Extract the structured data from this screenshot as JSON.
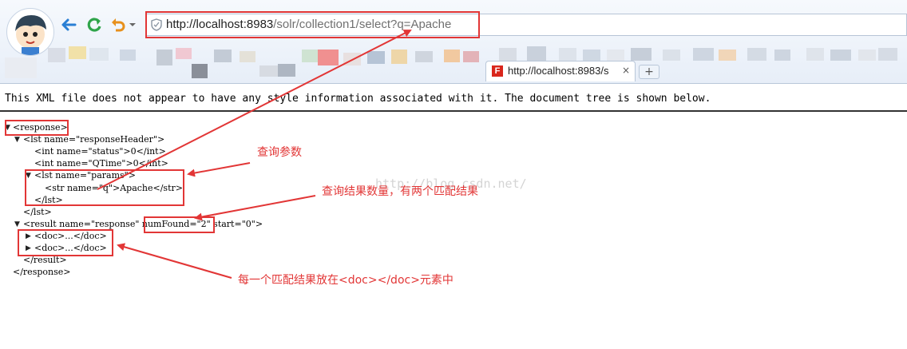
{
  "browser": {
    "url_host": "http://localhost:8983",
    "url_path": "/solr/collection1/select?q=Apache",
    "tab_title": "http://localhost:8983/s",
    "tab_favicon": "F",
    "tab_close": "×",
    "new_tab": "+",
    "icons": [
      "avatar",
      "back-arrow-icon",
      "refresh-icon",
      "undo-icon",
      "chevron-down-icon",
      "shield-icon"
    ]
  },
  "xml": {
    "info": "This XML file does not appear to have any style information associated with it. The document tree is shown below.",
    "lines": [
      "<response>",
      "<lst name=\"responseHeader\">",
      "<int name=\"status\">0</int>",
      "<int name=\"QTime\">0</int>",
      "<lst name=\"params\">",
      "<str name=\"q\">Apache</str>",
      "</lst>",
      "</lst>",
      "<result name=\"response\" numFound=\"2\" start=\"0\">",
      "<doc>...</doc>",
      "<doc>...</doc>",
      "</result>",
      "</response>"
    ]
  },
  "annotations": {
    "query_params": "查询参数",
    "result_count": "查询结果数量，有两个匹配结果",
    "each_result": "每一个匹配结果放在<doc></doc>元素中",
    "color": "#e23636"
  },
  "watermark": "http://blog.csdn.net/"
}
